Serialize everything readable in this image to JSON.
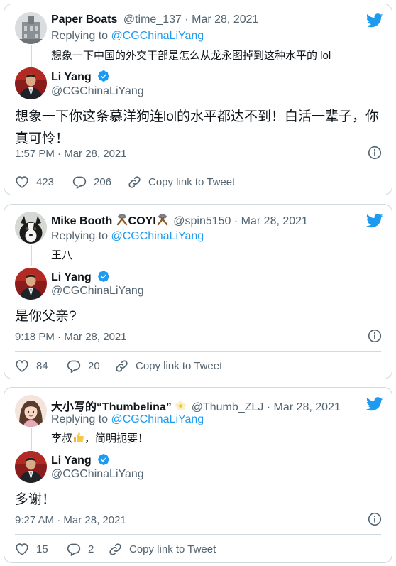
{
  "tweets": [
    {
      "parent": {
        "name": "Paper Boats",
        "handle": "@time_137",
        "sep": "·",
        "date": "Mar 28, 2021",
        "replying_prefix": "Replying to",
        "replying_to": "@CGChinaLiYang",
        "text": "想象一下中国的外交干部是怎么从龙永图掉到这种水平的 lol"
      },
      "reply": {
        "name": "Li Yang",
        "handle": "@CGChinaLiYang",
        "text": "想象一下你这条慕洋狗连lol的水平都达不到！白活一辈子，你真可怜！",
        "time": "1:57 PM",
        "sep": "·",
        "date": "Mar 28, 2021",
        "likes": "423",
        "replies": "206",
        "copy_link": "Copy link to Tweet"
      }
    },
    {
      "parent": {
        "name": "Mike Booth",
        "name_suffix": "COYI",
        "handle": "@spin5150",
        "sep": "·",
        "date": "Mar 28, 2021",
        "replying_prefix": "Replying to",
        "replying_to": "@CGChinaLiYang",
        "text": "王八"
      },
      "reply": {
        "name": "Li Yang",
        "handle": "@CGChinaLiYang",
        "text": "是你父亲?",
        "time": "9:18 PM",
        "sep": "·",
        "date": "Mar 28, 2021",
        "likes": "84",
        "replies": "20",
        "copy_link": "Copy link to Tweet"
      }
    },
    {
      "parent": {
        "name": "大小写的“Thumbelina”",
        "handle": "@Thumb_ZLJ",
        "sep": "·",
        "date": "Mar 28, 2021",
        "replying_prefix": "Replying to",
        "replying_to": "@CGChinaLiYang",
        "text_before": "李叔",
        "text_after": "，简明扼要！"
      },
      "reply": {
        "name": "Li Yang",
        "handle": "@CGChinaLiYang",
        "text": "多谢！",
        "time": "9:27 AM",
        "sep": "·",
        "date": "Mar 28, 2021",
        "likes": "15",
        "replies": "2",
        "copy_link": "Copy link to Tweet"
      }
    }
  ],
  "colors": {
    "twitter_blue": "#1d9bf0",
    "text": "#0f1419",
    "muted": "#536471",
    "border": "#cfd9de"
  },
  "icons": [
    "twitter-bird-icon",
    "verified-badge-icon",
    "heart-icon",
    "reply-icon",
    "link-icon",
    "info-icon",
    "hammers-emoji-icon",
    "thumbs-up-emoji-icon",
    "flower-emoji-icon"
  ]
}
